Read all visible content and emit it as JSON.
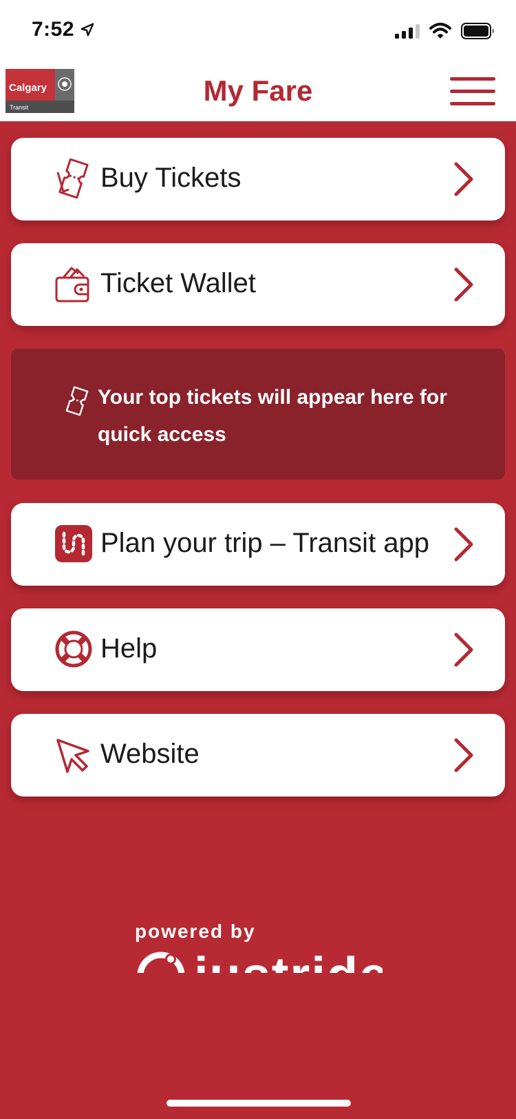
{
  "status_bar": {
    "time": "7:52"
  },
  "header": {
    "logo_text": "Calgary",
    "logo_subtext": "Transit",
    "title": "My Fare"
  },
  "menu": {
    "items": [
      {
        "label": "Buy Tickets",
        "icon": "ticket-icon"
      },
      {
        "label": "Ticket Wallet",
        "icon": "wallet-icon"
      },
      {
        "label": "Plan your trip – Transit app",
        "icon": "transit-app-icon"
      },
      {
        "label": "Help",
        "icon": "lifebuoy-icon"
      },
      {
        "label": "Website",
        "icon": "cursor-arrow-icon"
      }
    ]
  },
  "top_tickets": {
    "message": "Your top tickets will appear here for quick access",
    "icon": "ticket-outline-icon"
  },
  "footer": {
    "powered_by": "powered by",
    "brand": "justride"
  },
  "colors": {
    "brand_red": "#b42832",
    "background_red": "#b72a34",
    "banner_dark_red": "#8a222c",
    "card_white": "#ffffff",
    "text_dark": "#1b1b1b"
  }
}
